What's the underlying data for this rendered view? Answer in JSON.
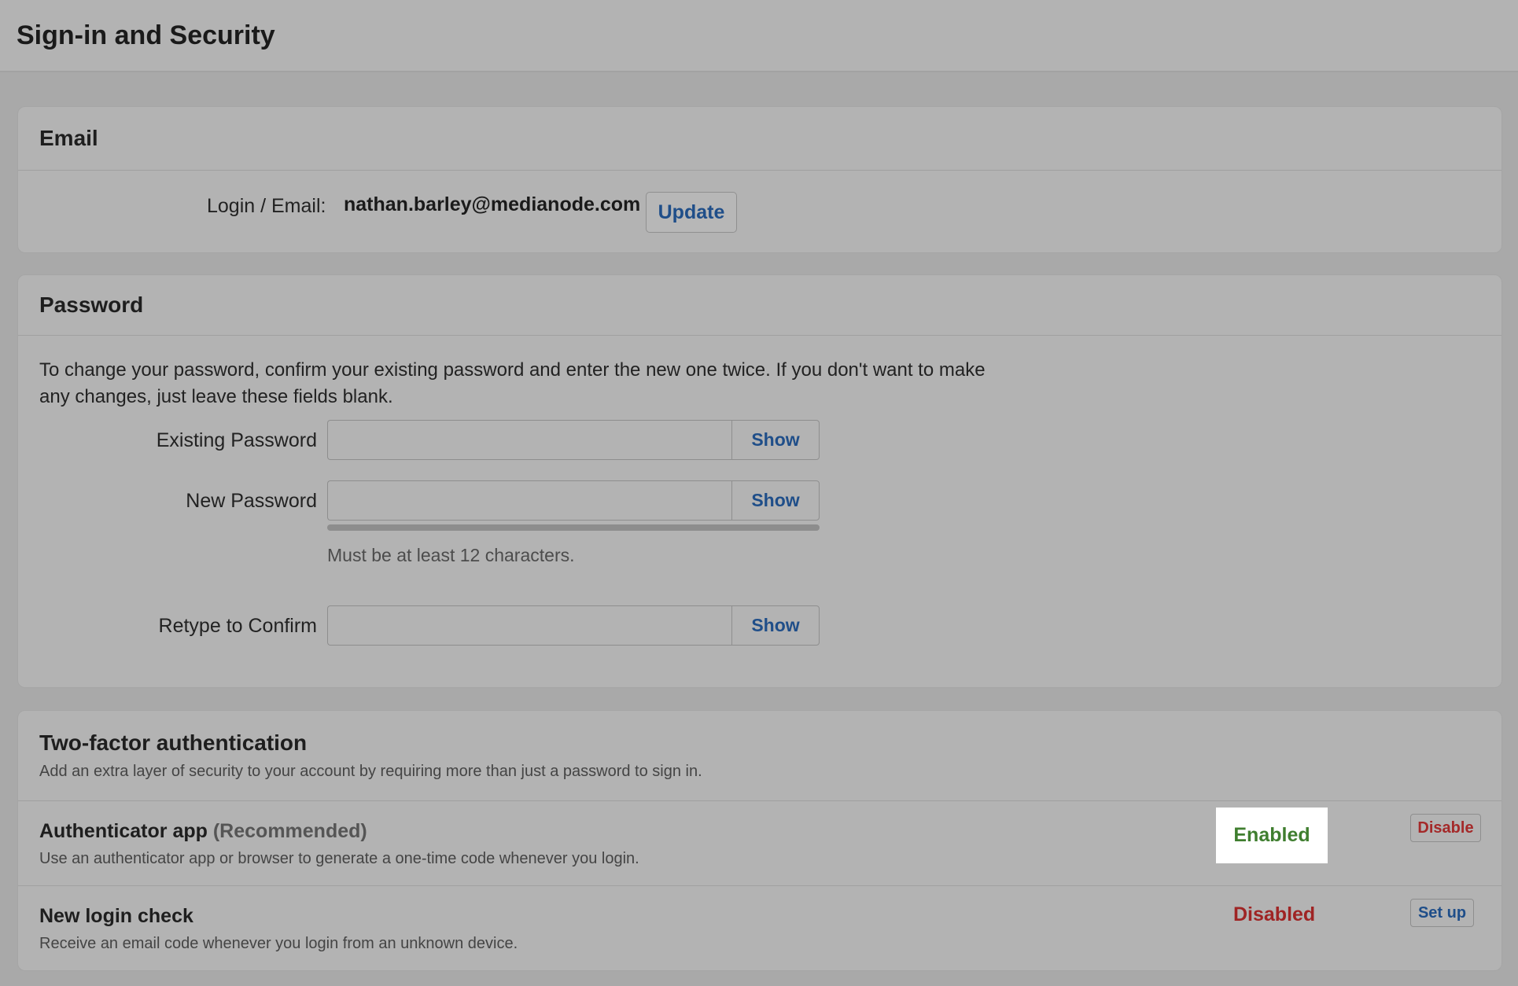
{
  "page": {
    "title": "Sign-in and Security"
  },
  "email_section": {
    "title": "Email",
    "login_label": "Login / Email:",
    "login_value": "nathan.barley@medianode.com",
    "update_label": "Update"
  },
  "password_section": {
    "title": "Password",
    "description": "To change your password, confirm your existing password and enter the new one twice. If you don't want to make any changes, just leave these fields blank.",
    "fields": [
      {
        "label": "Existing Password",
        "value": "",
        "show_label": "Show"
      },
      {
        "label": "New Password",
        "value": "",
        "show_label": "Show"
      },
      {
        "label": "Retype to Confirm",
        "value": "",
        "show_label": "Show"
      }
    ],
    "strength": 0,
    "hint": "Must be at least 12 characters."
  },
  "tfa_section": {
    "title": "Two-factor authentication",
    "subtitle": "Add an extra layer of security to your account by requiring more than just a password to sign in.",
    "methods": [
      {
        "title": "Authenticator app",
        "recommended": "(Recommended)",
        "description": "Use an authenticator app or browser to generate a one-time code whenever you login.",
        "status": "Enabled",
        "action_label": "Disable"
      },
      {
        "title": "New login check",
        "description": "Receive an email code whenever you login from an unknown device.",
        "status": "Disabled",
        "action_label": "Set up"
      }
    ]
  },
  "colors": {
    "background": "#a9a9a9",
    "link_blue": "#1f4e89",
    "enabled_green": "#3f7e2f",
    "disabled_red": "#9f2424"
  }
}
